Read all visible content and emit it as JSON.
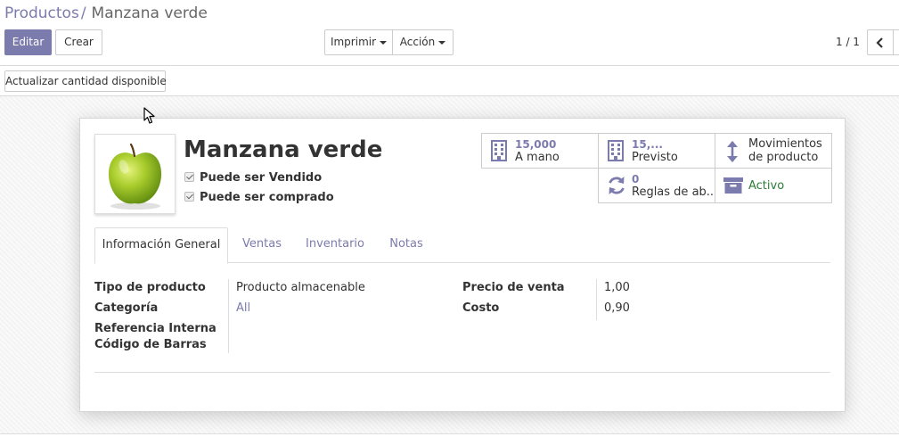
{
  "breadcrumb": {
    "parent": "Productos",
    "separator": "/",
    "current": "Manzana verde"
  },
  "toolbar": {
    "edit_label": "Editar",
    "create_label": "Crear",
    "print_label": "Imprimir",
    "action_label": "Acción"
  },
  "pager": {
    "value": "1 / 1"
  },
  "statusbar": {
    "update_qty_label": "Actualizar cantidad disponible"
  },
  "product": {
    "name": "Manzana verde",
    "can_be_sold_label": "Puede ser Vendido",
    "can_be_purchased_label": "Puede ser comprado",
    "can_be_sold": true,
    "can_be_purchased": true
  },
  "smart_buttons": {
    "on_hand": {
      "value": "15,000",
      "label": "A mano",
      "icon": "building-icon"
    },
    "forecast": {
      "value": "15,...",
      "label": "Previsto",
      "icon": "building-icon"
    },
    "moves": {
      "line1": "Movimientos",
      "line2": "de producto",
      "icon": "vertical-arrows-icon"
    },
    "reorder": {
      "value": "0",
      "label": "Reglas de ab...",
      "icon": "refresh-icon"
    },
    "active": {
      "label": "Activo",
      "icon": "archive-icon"
    }
  },
  "tabs": [
    {
      "label": "Información General",
      "active": true
    },
    {
      "label": "Ventas",
      "active": false
    },
    {
      "label": "Inventario",
      "active": false
    },
    {
      "label": "Notas",
      "active": false
    }
  ],
  "fields": {
    "product_type": {
      "label": "Tipo de producto",
      "value": "Producto almacenable"
    },
    "category": {
      "label": "Categoría",
      "value": "All"
    },
    "internal_ref": {
      "label": "Referencia Interna",
      "value": ""
    },
    "barcode": {
      "label": "Código de Barras",
      "value": ""
    },
    "sale_price": {
      "label": "Precio de venta",
      "value": "1,00"
    },
    "cost": {
      "label": "Costo",
      "value": "0,90"
    }
  },
  "colors": {
    "primary": "#7c7bad",
    "active_green": "#2d7b38"
  }
}
